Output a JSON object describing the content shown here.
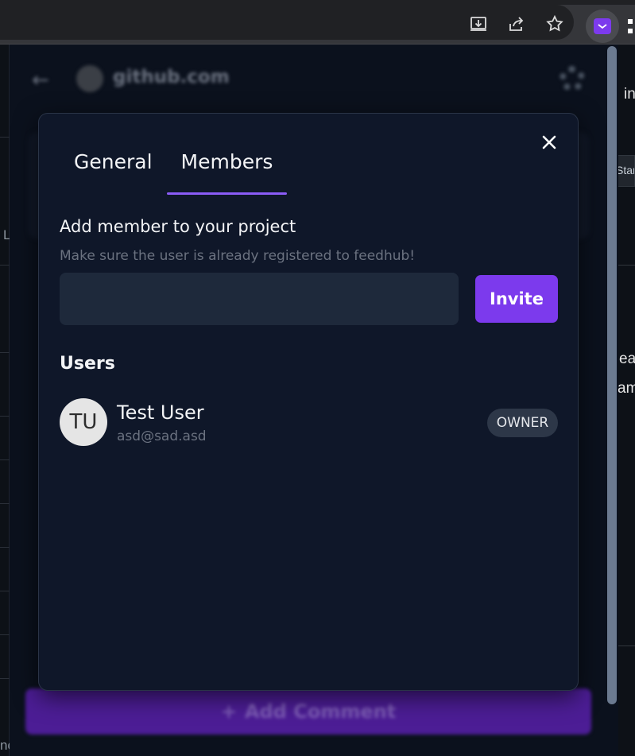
{
  "browser": {
    "icons": [
      "download-icon",
      "share-icon",
      "star-icon",
      "feedhub-extension-icon",
      "more-icon"
    ]
  },
  "background_page": {
    "snippets": [
      "in",
      "Star",
      "ea",
      "am",
      "L",
      "nc"
    ]
  },
  "popup": {
    "site_name": "github.com",
    "add_comment_label": "Add Comment"
  },
  "modal": {
    "tabs": [
      {
        "label": "General",
        "active": false
      },
      {
        "label": "Members",
        "active": true
      }
    ],
    "add_member": {
      "title": "Add member to your project",
      "subtitle": "Make sure the user is already registered to feedhub!",
      "input_value": "",
      "invite_label": "Invite"
    },
    "users_title": "Users",
    "users": [
      {
        "initials": "TU",
        "name": "Test User",
        "email": "asd@sad.asd",
        "role": "OWNER"
      }
    ]
  },
  "colors": {
    "accent": "#7c3aed",
    "tab_underline": "#8b5cf6",
    "modal_bg": "#0f1729",
    "input_bg": "#1e293b"
  }
}
